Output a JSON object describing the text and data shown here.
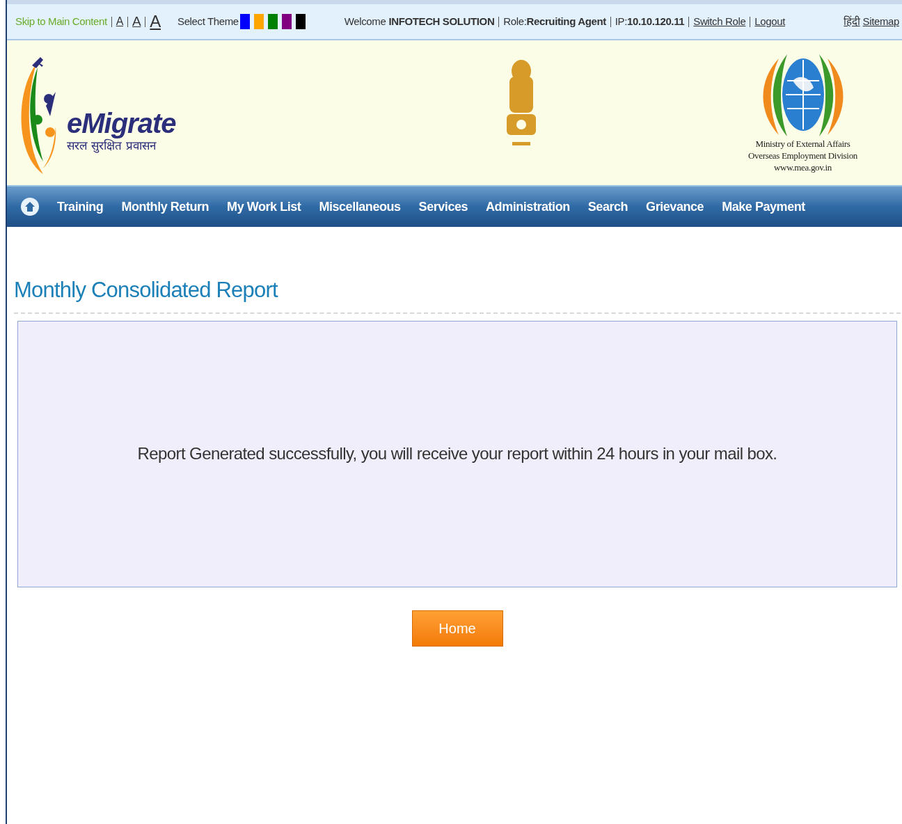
{
  "top_bar": {
    "skip_link": "Skip to Main Content",
    "font_sizes": [
      "A",
      "A",
      "A"
    ],
    "theme_label": "Select Theme",
    "themes": [
      {
        "color": "#0000ff"
      },
      {
        "color": "#ffa500"
      },
      {
        "color": "#008000"
      },
      {
        "color": "#800080"
      },
      {
        "color": "#000000"
      }
    ],
    "welcome_prefix": "Welcome",
    "user": "INFOTECH SOLUTION",
    "role_prefix": "Role:",
    "role": "Recruiting Agent",
    "ip_prefix": "IP:",
    "ip": "10.10.120.11",
    "links": [
      "Switch Role",
      "Logout"
    ],
    "language_link": "हिंदी",
    "sitemap_link": "Sitemap"
  },
  "header": {
    "logo_title": "eMigrate",
    "logo_tagline": "सरल सुरक्षित प्रवासन",
    "ministry_lines": [
      "Ministry of External Affairs",
      "Overseas Employment Division",
      "www.mea.gov.in"
    ]
  },
  "nav": {
    "items": [
      "Training",
      "Monthly Return",
      "My Work List",
      "Miscellaneous",
      "Services",
      "Administration",
      "Search",
      "Grievance",
      "Make Payment"
    ]
  },
  "page": {
    "title": "Monthly Consolidated Report",
    "message": "Report Generated successfully, you will receive your report within 24 hours in your mail box.",
    "button": "Home"
  }
}
